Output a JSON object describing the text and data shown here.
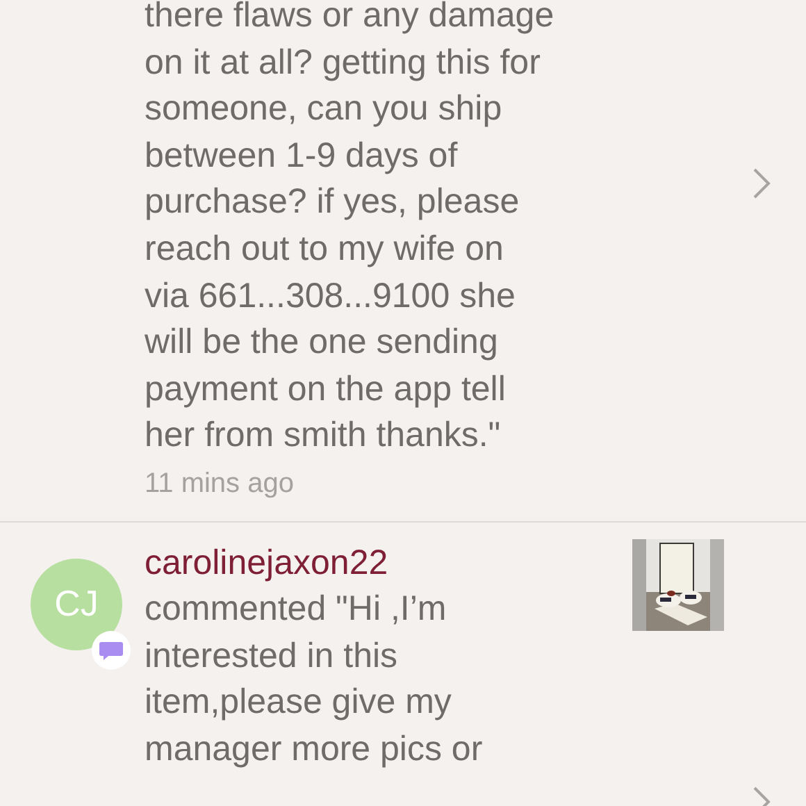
{
  "notifications": [
    {
      "kind": "continued",
      "message_lines": [
        "there flaws or any damage",
        "on it at all? getting this for",
        "someone, can you ship",
        "between 1-9 days of",
        "purchase? if yes, please",
        "reach out to my wife on",
        "via 661...308...9100 she",
        "will be the one sending",
        "payment on the app tell",
        "her from smith thanks.\""
      ],
      "time": "11 mins ago"
    },
    {
      "kind": "comment",
      "avatar_initials": "CJ",
      "username": "carolinejaxon22",
      "message_lines": [
        "commented \"Hi ,I’m",
        "interested in this",
        "item,please give my",
        "manager more pics or"
      ]
    }
  ]
}
